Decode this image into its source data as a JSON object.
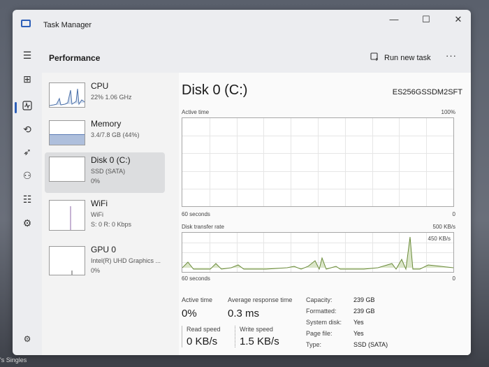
{
  "window": {
    "title": "Task Manager"
  },
  "controls": {
    "minimize": "—",
    "maximize": "☐",
    "close": "✕"
  },
  "header": {
    "title": "Performance",
    "run_task": "Run new task",
    "more": "···"
  },
  "devices": [
    {
      "name": "CPU",
      "line1": "22%  1.06 GHz",
      "line2": ""
    },
    {
      "name": "Memory",
      "line1": "3.4/7.8 GB (44%)",
      "line2": ""
    },
    {
      "name": "Disk 0 (C:)",
      "line1": "SSD (SATA)",
      "line2": "0%"
    },
    {
      "name": "WiFi",
      "line1": "WiFi",
      "line2": "S: 0  R: 0 Kbps"
    },
    {
      "name": "GPU 0",
      "line1": "Intel(R) UHD Graphics ...",
      "line2": "0%"
    }
  ],
  "detail": {
    "title": "Disk 0 (C:)",
    "model": "ES256GSSDM2SFT",
    "graph1": {
      "label": "Active time",
      "max": "100%",
      "x_left": "60 seconds",
      "x_right": "0"
    },
    "graph2": {
      "label": "Disk transfer rate",
      "max": "500 KB/s",
      "peak": "450 KB/s",
      "x_left": "60 seconds",
      "x_right": "0"
    },
    "stats": {
      "active_time_label": "Active time",
      "active_time": "0%",
      "resp_label": "Average response time",
      "resp": "0.3 ms",
      "read_label": "Read speed",
      "read": "0 KB/s",
      "write_label": "Write speed",
      "write": "1.5 KB/s"
    },
    "info": {
      "capacity_label": "Capacity:",
      "capacity": "239 GB",
      "formatted_label": "Formatted:",
      "formatted": "239 GB",
      "system_label": "System disk:",
      "system": "Yes",
      "page_label": "Page file:",
      "page": "Yes",
      "type_label": "Type:",
      "type": "SSD (SATA)"
    }
  },
  "desktop": {
    "text": "'s Singles"
  },
  "colors": {
    "accent": "#2d5fb8",
    "memory_fill": "#aebfdc",
    "disk_line": "#6a8a3a"
  },
  "icons": [
    "hamburger-icon",
    "processes-icon",
    "performance-icon",
    "history-icon",
    "startup-icon",
    "users-icon",
    "details-icon",
    "services-icon",
    "settings-icon",
    "run-task-icon"
  ]
}
